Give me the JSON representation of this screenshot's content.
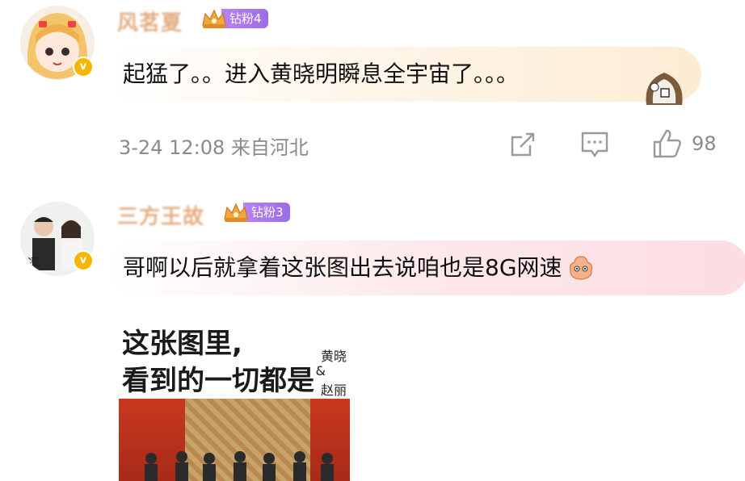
{
  "comments": [
    {
      "username": "风茗夏",
      "fan_badge": "钻粉4",
      "text": "起猛了。。进入黄晓明瞬息全宇宙了。。。",
      "meta": "3-24 12:08 来自河北",
      "like_count": "98"
    },
    {
      "username": "三方王故",
      "fan_badge": "钻粉3",
      "text": "哥啊以后就拿着这张图出去说咱也是8G网速",
      "image": {
        "line1": "这张图里,",
        "line2": "看到的一切都是",
        "side_name_1": "黄晓",
        "side_amp": "&",
        "side_name_2": "赵丽"
      }
    }
  ],
  "colors": {
    "fan_badge": "#a874ec",
    "meta": "#8a8a8a",
    "vip_badge": "#f7b500"
  }
}
